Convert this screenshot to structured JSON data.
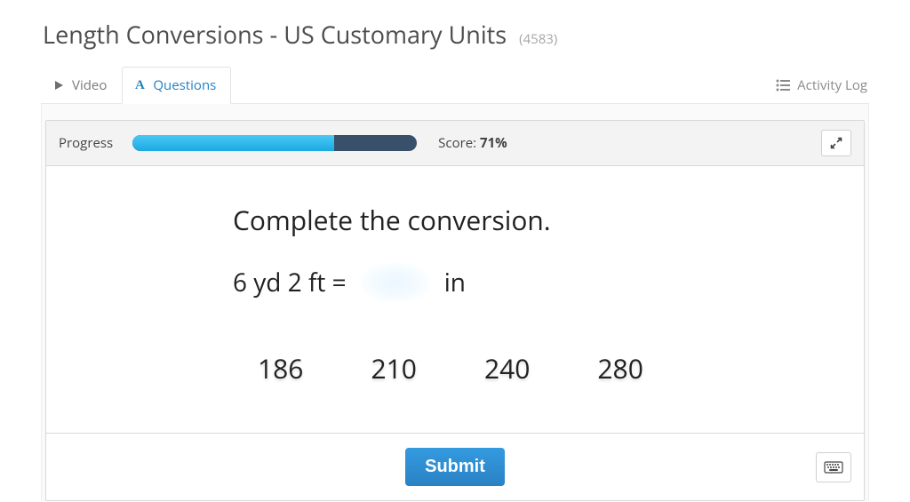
{
  "header": {
    "title": "Length Conversions - US Customary Units",
    "count": "(4583)"
  },
  "tabs": {
    "video": "Video",
    "questions": "Questions",
    "activity_log": "Activity Log"
  },
  "progress": {
    "label": "Progress",
    "percent": 71,
    "score_label": "Score:",
    "score_value": "71%"
  },
  "question": {
    "prompt": "Complete the conversion.",
    "lhs": "6 yd 2 ft =",
    "rhs_unit": "in",
    "options": [
      "186",
      "210",
      "240",
      "280"
    ]
  },
  "footer": {
    "submit": "Submit"
  }
}
